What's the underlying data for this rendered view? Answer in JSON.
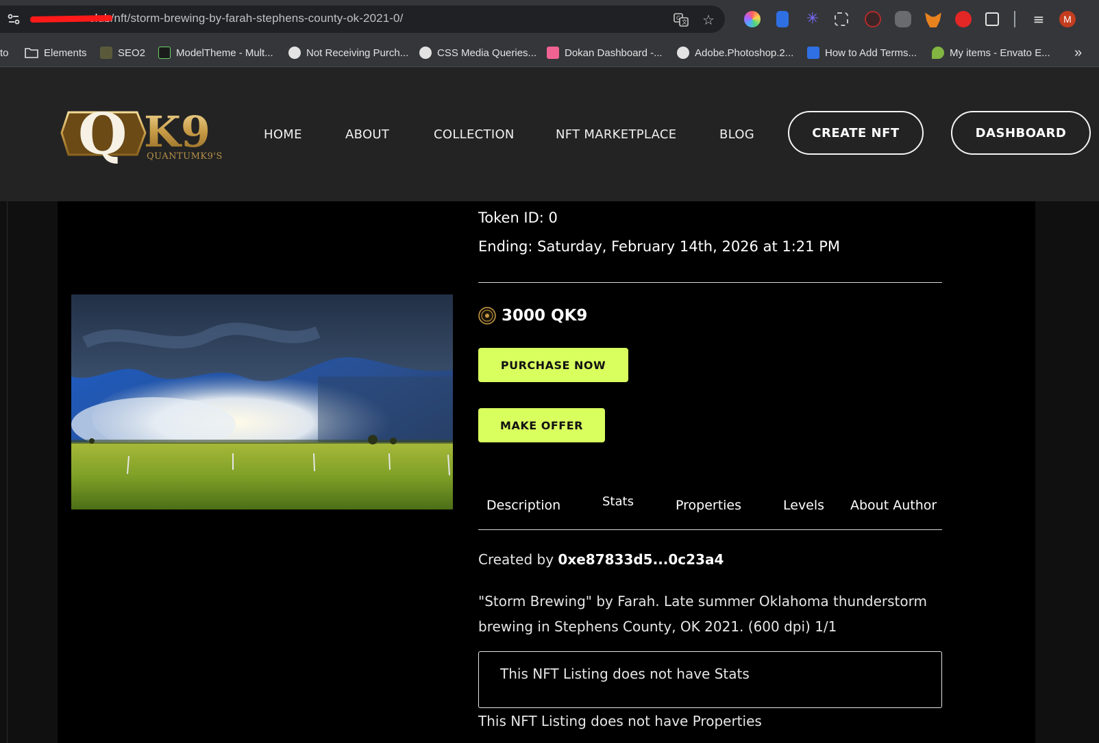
{
  "browser": {
    "url_host": "club",
    "url_path": "/nft/storm-brewing-by-farah-stephens-county-ok-2021-0/",
    "bookmarks": [
      {
        "label": "to"
      },
      {
        "label": "Elements"
      },
      {
        "label": "SEO2"
      },
      {
        "label": "ModelTheme - Mult..."
      },
      {
        "label": "Not Receiving Purch..."
      },
      {
        "label": "CSS Media Queries..."
      },
      {
        "label": "Dokan Dashboard -..."
      },
      {
        "label": "Adobe.Photoshop.2..."
      },
      {
        "label": "How to Add Terms..."
      },
      {
        "label": "My items - Envato E..."
      }
    ],
    "more_bookmarks": "»",
    "profile_initial": "M"
  },
  "site": {
    "logo_text": "K9",
    "logo_letter": "Q",
    "logo_subtext": "QUANTUMK9'S",
    "nav": [
      "HOME",
      "ABOUT",
      "COLLECTION",
      "NFT MARKETPLACE",
      "BLOG"
    ],
    "create_button": "CREATE NFT",
    "dashboard_button": "DASHBOARD"
  },
  "nft": {
    "token": "Token ID: 0",
    "ending": "Ending: Saturday, February 14th, 2026 at 1:21 PM",
    "price": "3000 QK9",
    "purchase_label": "PURCHASE NOW",
    "offer_label": "MAKE OFFER",
    "tabs": [
      "Description",
      "Stats",
      "Properties",
      "Levels",
      "About Author"
    ],
    "created_prefix": "Created by",
    "creator": "0xe87833d5...0c23a4",
    "description": "\"Storm Brewing\" by Farah. Late summer Oklahoma thunderstorm brewing in Stephens County, OK 2021. (600 dpi) 1/1",
    "stats_empty": "This NFT Listing does not have Stats",
    "properties_empty": "This NFT Listing does not have Properties"
  },
  "colors": {
    "accent": "#d9ff5f",
    "header_bg": "#232323",
    "page_bg": "#000000"
  }
}
